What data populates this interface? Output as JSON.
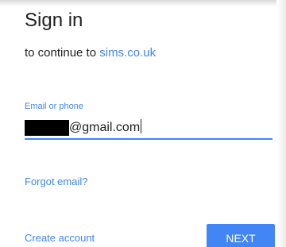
{
  "header": {
    "title": "Sign in",
    "subtitle_prefix": "to continue to ",
    "subtitle_link": "sims.co.uk"
  },
  "email_field": {
    "label": "Email or phone",
    "value": "@gmail.com"
  },
  "links": {
    "forgot_email": "Forgot email?",
    "create_account": "Create account"
  },
  "actions": {
    "next_label": "NEXT"
  },
  "colors": {
    "accent": "#4285f4",
    "text": "#212121"
  }
}
